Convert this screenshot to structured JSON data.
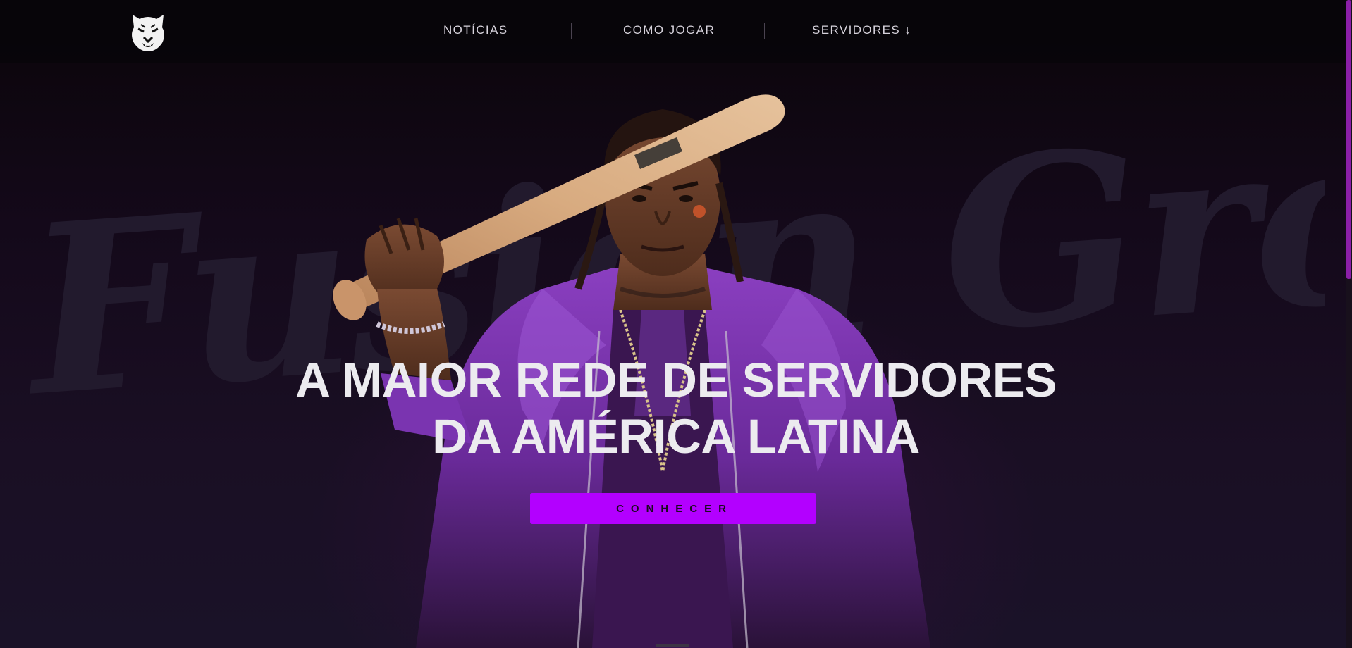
{
  "nav": {
    "logo_icon": "tiger-head-icon",
    "items": [
      {
        "label": "NOTÍCIAS"
      },
      {
        "label": "COMO JOGAR"
      },
      {
        "label": "SERVIDORES ↓"
      }
    ]
  },
  "hero": {
    "watermark": "Fusion Group",
    "headline_line1": "A MAIOR REDE DE SERVIDORES",
    "headline_line2": "DA AMÉRICA LATINA",
    "cta_label": "CONHECER"
  },
  "colors": {
    "accent": "#b300ff",
    "background": "#14091a",
    "text": "#ecebef"
  }
}
